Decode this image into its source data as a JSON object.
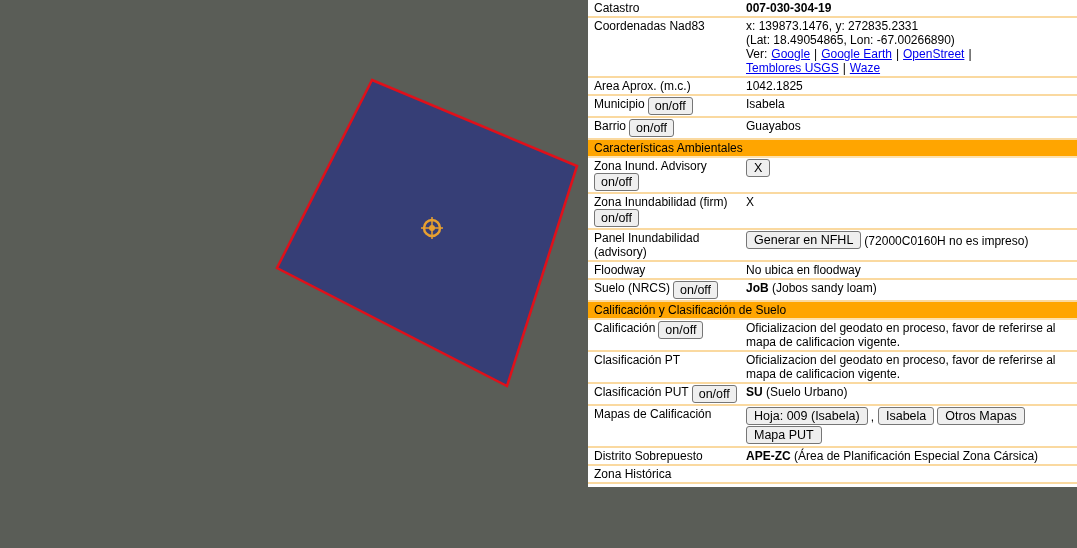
{
  "rows": [
    {
      "kind": "field",
      "label": "Catastro",
      "lines": [
        [
          {
            "kind": "text",
            "text": "007-030-304-19",
            "bold": true
          }
        ]
      ]
    },
    {
      "kind": "field",
      "label": "Coordenadas Nad83",
      "lines": [
        [
          {
            "kind": "text",
            "text": "x: 139873.1476, y: 272835.2331"
          }
        ],
        [
          {
            "kind": "text",
            "text": "(Lat: 18.49054865, Lon: -67.00266890)"
          }
        ],
        [
          {
            "kind": "text",
            "text": "Ver:"
          },
          {
            "kind": "link",
            "text": "Google"
          },
          {
            "kind": "text",
            "text": "|"
          },
          {
            "kind": "link",
            "text": "Google Earth"
          },
          {
            "kind": "text",
            "text": "|"
          },
          {
            "kind": "link",
            "text": "OpenStreet"
          },
          {
            "kind": "text",
            "text": "|"
          },
          {
            "kind": "link",
            "text": "Temblores USGS"
          },
          {
            "kind": "text",
            "text": "|"
          },
          {
            "kind": "link",
            "text": "Waze"
          }
        ]
      ]
    },
    {
      "kind": "field",
      "label": "Area Aprox. (m.c.)",
      "lines": [
        [
          {
            "kind": "text",
            "text": "1042.1825"
          }
        ]
      ]
    },
    {
      "kind": "field",
      "label": "Municipio",
      "toggle": "on/off",
      "lines": [
        [
          {
            "kind": "text",
            "text": "Isabela"
          }
        ]
      ]
    },
    {
      "kind": "field",
      "label": "Barrio",
      "toggle": "on/off",
      "lines": [
        [
          {
            "kind": "text",
            "text": "Guayabos"
          }
        ]
      ]
    },
    {
      "kind": "section",
      "label": "Características Ambientales"
    },
    {
      "kind": "field",
      "label": "Zona Inund. Advisory",
      "toggle": "on/off",
      "lines": [
        [
          {
            "kind": "button",
            "text": "X"
          }
        ]
      ]
    },
    {
      "kind": "field",
      "label": "Zona Inundabilidad (firm)",
      "toggle": "on/off",
      "lines": [
        [
          {
            "kind": "text",
            "text": "X"
          }
        ]
      ]
    },
    {
      "kind": "field",
      "label": "Panel Inundabilidad (advisory)",
      "lines": [
        [
          {
            "kind": "button",
            "text": "Generar en NFHL"
          },
          {
            "kind": "text",
            "text": "(72000C0160H no es impreso)"
          }
        ]
      ]
    },
    {
      "kind": "field",
      "label": "Floodway",
      "lines": [
        [
          {
            "kind": "text",
            "text": "No ubica en floodway"
          }
        ]
      ]
    },
    {
      "kind": "field",
      "label": "Suelo (NRCS)",
      "toggle": "on/off",
      "lines": [
        [
          {
            "kind": "text",
            "text": "**JoB** (Jobos sandy loam)"
          }
        ]
      ]
    },
    {
      "kind": "section",
      "label": "Calificación y Clasificación de Suelo"
    },
    {
      "kind": "field",
      "label": "Calificación",
      "toggle": "on/off",
      "lines": [
        [
          {
            "kind": "text",
            "text": "Oficializacion del geodato en proceso, favor de referirse al mapa de calificacion vigente."
          }
        ]
      ]
    },
    {
      "kind": "field",
      "label": "Clasificación PT",
      "lines": [
        [
          {
            "kind": "text",
            "text": "Oficializacion del geodato en proceso, favor de referirse al mapa de calificacion vigente."
          }
        ]
      ]
    },
    {
      "kind": "field",
      "label": "Clasificación PUT",
      "toggle": "on/off",
      "lines": [
        [
          {
            "kind": "text",
            "text": "**SU** (Suelo Urbano)"
          }
        ]
      ]
    },
    {
      "kind": "field",
      "label": "Mapas de Calificación",
      "lines": [
        [
          {
            "kind": "button",
            "text": "Hoja: 009 (Isabela)"
          },
          {
            "kind": "text",
            "text": ","
          },
          {
            "kind": "button",
            "text": "Isabela"
          },
          {
            "kind": "button",
            "text": "Otros Mapas"
          },
          {
            "kind": "button",
            "text": "Mapa PUT"
          }
        ]
      ]
    },
    {
      "kind": "field",
      "label": "Distrito Sobrepuesto",
      "lines": [
        [
          {
            "kind": "text",
            "text": "**APE-ZC** (Área de Planificación Especial Zona Cársica)"
          }
        ]
      ]
    },
    {
      "kind": "field",
      "label": "Zona Histórica",
      "lines": []
    }
  ]
}
